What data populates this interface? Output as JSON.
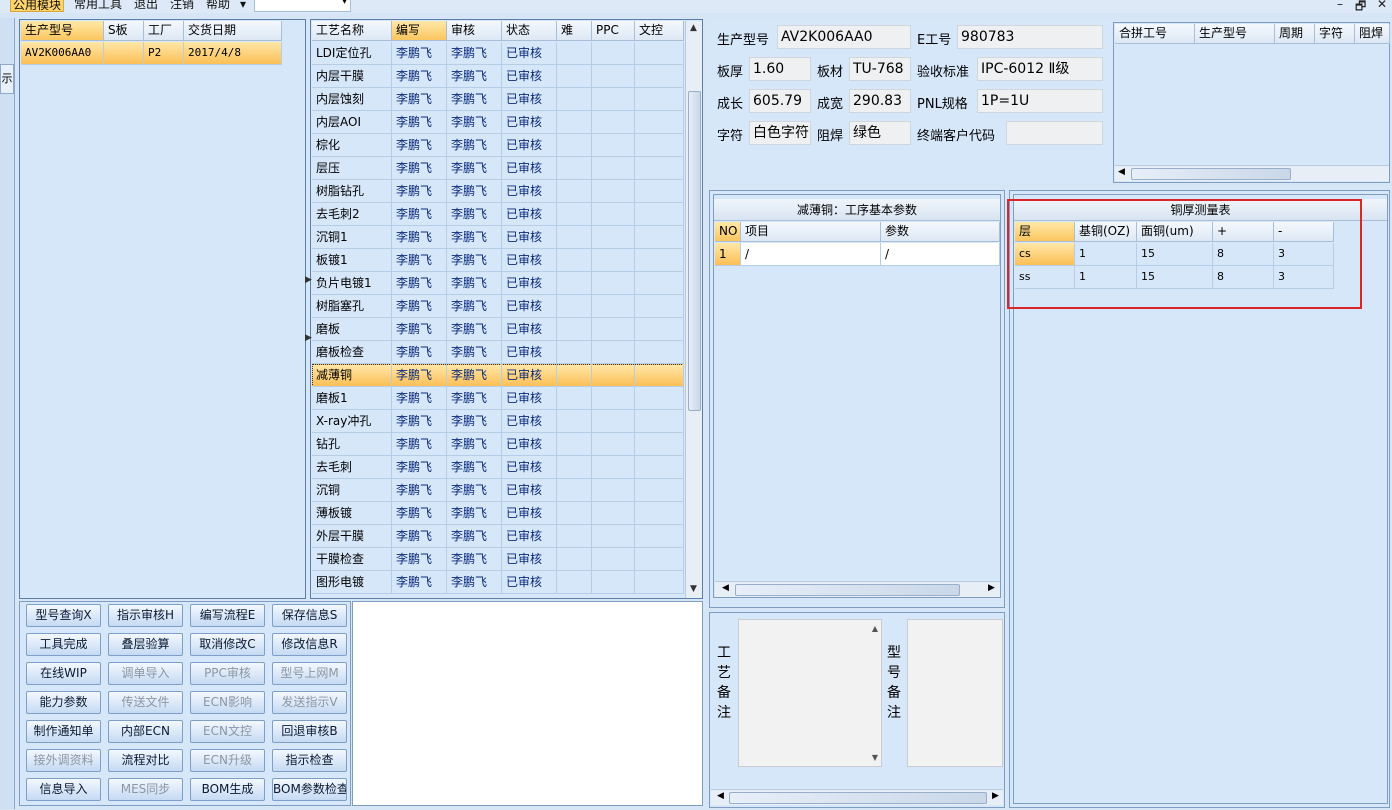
{
  "menu": {
    "items": [
      "公用模块",
      "常用工具",
      "退出",
      "注销",
      "帮助"
    ],
    "dropdown_arrow": "▾",
    "window_controls": [
      "–",
      "🗗",
      "✕"
    ]
  },
  "left_tab_text": "示",
  "model_table": {
    "headers": [
      "生产型号",
      "S板",
      "工厂",
      "交货日期"
    ],
    "rows": [
      [
        "AV2K006AA0",
        "",
        "P2",
        "2017/4/8"
      ]
    ]
  },
  "process_table": {
    "headers": [
      "工艺名称",
      "编写",
      "审核",
      "状态",
      "难",
      "PPC",
      "文控"
    ],
    "rows": [
      [
        "LDI定位孔",
        "李鹏飞",
        "李鹏飞",
        "已审核"
      ],
      [
        "内层干膜",
        "李鹏飞",
        "李鹏飞",
        "已审核"
      ],
      [
        "内层蚀刻",
        "李鹏飞",
        "李鹏飞",
        "已审核"
      ],
      [
        "内层AOI",
        "李鹏飞",
        "李鹏飞",
        "已审核"
      ],
      [
        "棕化",
        "李鹏飞",
        "李鹏飞",
        "已审核"
      ],
      [
        "层压",
        "李鹏飞",
        "李鹏飞",
        "已审核"
      ],
      [
        "树脂钻孔",
        "李鹏飞",
        "李鹏飞",
        "已审核"
      ],
      [
        "去毛刺2",
        "李鹏飞",
        "李鹏飞",
        "已审核"
      ],
      [
        "沉铜1",
        "李鹏飞",
        "李鹏飞",
        "已审核"
      ],
      [
        "板镀1",
        "李鹏飞",
        "李鹏飞",
        "已审核"
      ],
      [
        "负片电镀1",
        "李鹏飞",
        "李鹏飞",
        "已审核"
      ],
      [
        "树脂塞孔",
        "李鹏飞",
        "李鹏飞",
        "已审核"
      ],
      [
        "磨板",
        "李鹏飞",
        "李鹏飞",
        "已审核"
      ],
      [
        "磨板检查",
        "李鹏飞",
        "李鹏飞",
        "已审核"
      ],
      [
        "减薄铜",
        "李鹏飞",
        "李鹏飞",
        "已审核"
      ],
      [
        "磨板1",
        "李鹏飞",
        "李鹏飞",
        "已审核"
      ],
      [
        "X-ray冲孔",
        "李鹏飞",
        "李鹏飞",
        "已审核"
      ],
      [
        "钻孔",
        "李鹏飞",
        "李鹏飞",
        "已审核"
      ],
      [
        "去毛刺",
        "李鹏飞",
        "李鹏飞",
        "已审核"
      ],
      [
        "沉铜",
        "李鹏飞",
        "李鹏飞",
        "已审核"
      ],
      [
        "薄板镀",
        "李鹏飞",
        "李鹏飞",
        "已审核"
      ],
      [
        "外层干膜",
        "李鹏飞",
        "李鹏飞",
        "已审核"
      ],
      [
        "干膜检查",
        "李鹏飞",
        "李鹏飞",
        "已审核"
      ],
      [
        "图形电镀",
        "李鹏飞",
        "李鹏飞",
        "已审核"
      ]
    ],
    "selected_row": 14
  },
  "info": {
    "model_label": "生产型号",
    "model_value": "AV2K006AA0",
    "eno_label": "E工号",
    "eno_value": "980783",
    "thickness_label": "板厚",
    "thickness_value": "1.60",
    "material_label": "板材",
    "material_value": "TU-768",
    "standard_label": "验收标准",
    "standard_value": "IPC-6012 Ⅱ级",
    "length_label": "成长",
    "length_value": "605.79",
    "width_label": "成宽",
    "width_value": "290.83",
    "pnl_label": "PNL规格",
    "pnl_value": "1P=1U",
    "char_label": "字符",
    "char_value": "白色字符",
    "mask_label": "阻焊",
    "mask_value": "绿色",
    "customer_label": "终端客户代码",
    "customer_value": ""
  },
  "combine_table": {
    "headers": [
      "合拼工号",
      "生产型号",
      "周期",
      "字符",
      "阻焊"
    ]
  },
  "params": {
    "title": "减薄铜：工序基本参数",
    "headers": [
      "NO",
      "项目",
      "参数"
    ],
    "rows": [
      [
        "1",
        "/",
        "/"
      ]
    ]
  },
  "thickness": {
    "title": "铜厚测量表",
    "headers": [
      "层",
      "基铜(OZ)",
      "面铜(um)",
      "+",
      "-"
    ],
    "rows": [
      [
        "cs",
        "1",
        "15",
        "8",
        "3"
      ],
      [
        "ss",
        "1",
        "15",
        "8",
        "3"
      ]
    ]
  },
  "remarks": {
    "process_label": [
      "工",
      "艺",
      "备",
      "注"
    ],
    "model_label": [
      "型",
      "号",
      "备",
      "注"
    ]
  },
  "buttons": [
    [
      "型号查询X",
      "指示审核H",
      "编写流程E",
      "保存信息S"
    ],
    [
      "工具完成",
      "叠层验算",
      "取消修改C",
      "修改信息R"
    ],
    [
      "在线WIP",
      "调单导入",
      "PPC审核",
      "型号上网M"
    ],
    [
      "能力参数",
      "传送文件",
      "ECN影响",
      "发送指示V"
    ],
    [
      "制作通知单",
      "内部ECN",
      "ECN文控",
      "回退审核B"
    ],
    [
      "接外调资料",
      "流程对比",
      "ECN升级",
      "指示检查"
    ],
    [
      "信息导入",
      "MES同步",
      "BOM生成",
      "BOM参数检查"
    ]
  ],
  "buttons_disabled": [
    [
      false,
      false,
      false,
      false
    ],
    [
      false,
      false,
      false,
      false
    ],
    [
      false,
      true,
      true,
      true
    ],
    [
      false,
      true,
      true,
      true
    ],
    [
      false,
      false,
      true,
      false
    ],
    [
      true,
      false,
      true,
      false
    ],
    [
      false,
      true,
      false,
      false
    ]
  ],
  "colors": {
    "selection": "#fbc65f",
    "annotation_red": "#d9262b",
    "panel_bg": "#d6e7fa"
  }
}
